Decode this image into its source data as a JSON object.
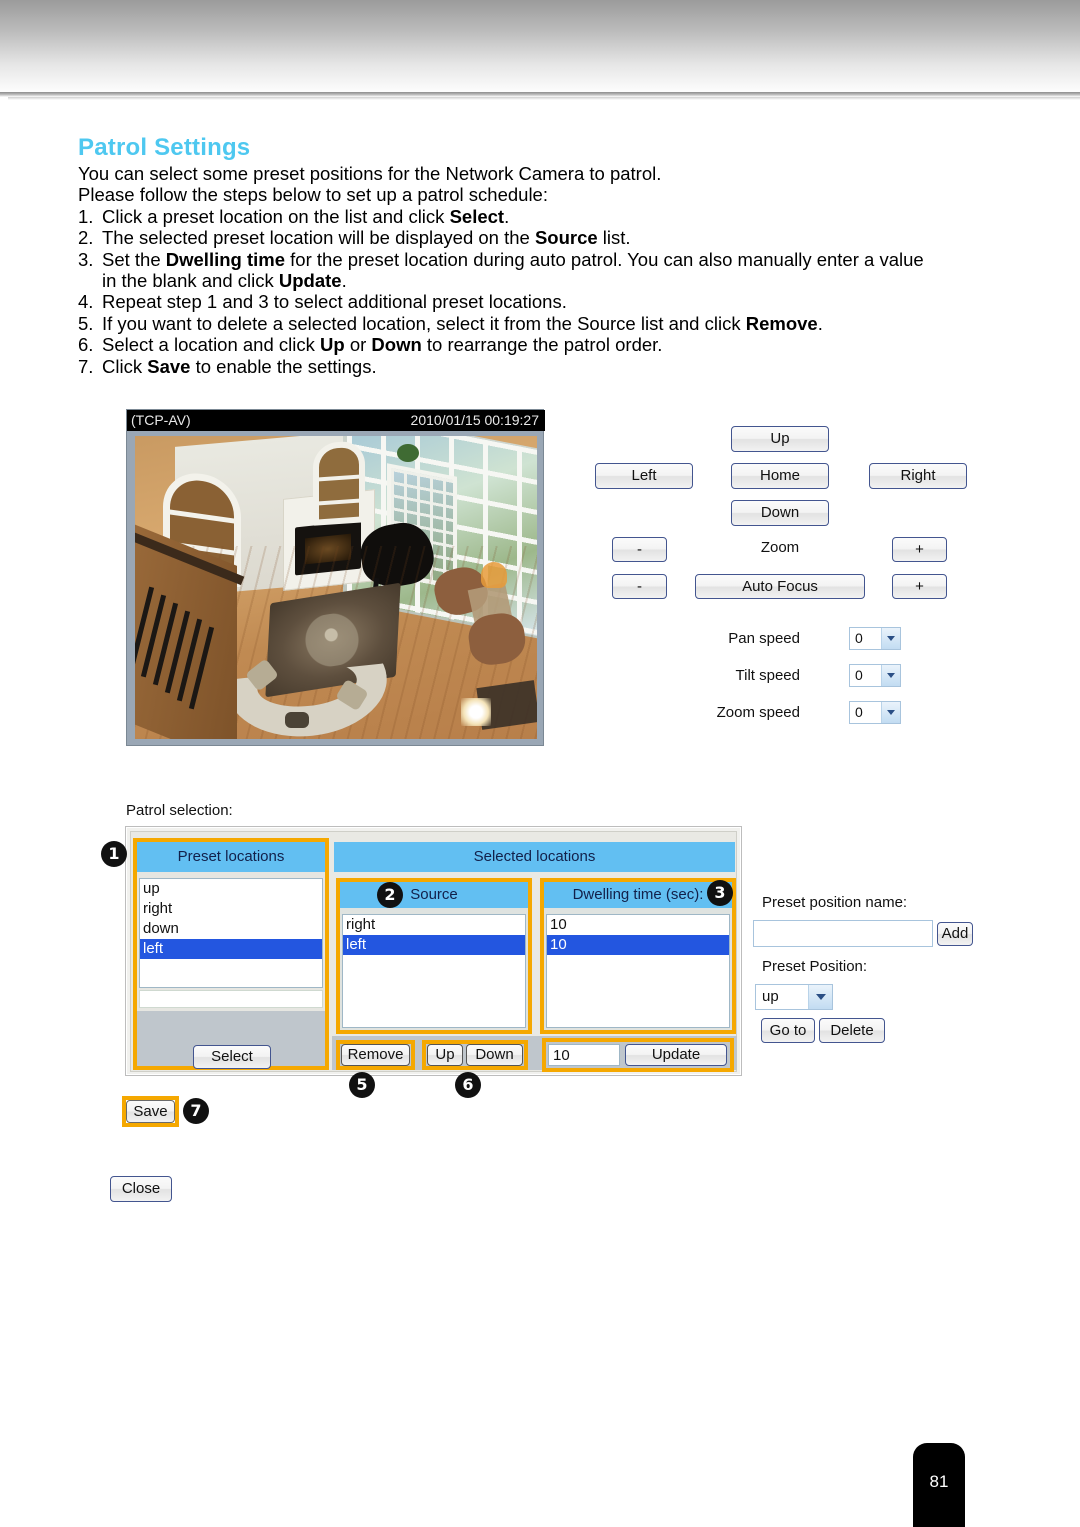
{
  "page": {
    "title": "Patrol Settings",
    "number": "81"
  },
  "intro": {
    "line1": "You can select some preset positions for the Network Camera to patrol.",
    "line2": "Please follow the steps below to set up a patrol schedule:",
    "steps": [
      {
        "num": "1.",
        "pre": "Click a preset location on the list and click ",
        "bold": "Select",
        "post": "."
      },
      {
        "num": "2.",
        "pre": "The selected preset location will be displayed on the ",
        "bold": "Source",
        "post": " list."
      },
      {
        "num": "3.",
        "pre": "Set the ",
        "bold": "Dwelling time",
        "post": " for the preset location during auto patrol. You can also manually enter a value",
        "cont_pre": "in the blank and click ",
        "cont_bold": "Update",
        "cont_post": "."
      },
      {
        "num": "4.",
        "pre": "Repeat step 1 and 3 to select additional preset locations.",
        "bold": "",
        "post": ""
      },
      {
        "num": "5.",
        "pre": "If you want to delete a selected location, select it from the Source list and click ",
        "bold": "Remove",
        "post": "."
      },
      {
        "num": "6.",
        "pre": "Select a location and click ",
        "bold": "Up",
        "mid": " or ",
        "bold2": "Down",
        "post": " to rearrange the patrol order."
      },
      {
        "num": "7.",
        "pre": "Click ",
        "bold": "Save",
        "post": " to enable the settings."
      }
    ]
  },
  "video": {
    "osd_left": "(TCP-AV)",
    "osd_time": "2010/01/15 00:19:27"
  },
  "ptz": {
    "up": "Up",
    "left": "Left",
    "home": "Home",
    "right": "Right",
    "down": "Down",
    "zoom_label": "Zoom",
    "zoom_minus": "-",
    "zoom_plus": "+",
    "focus_minus": "-",
    "focus_plus": "+",
    "auto_focus": "Auto Focus",
    "pan_speed_label": "Pan speed",
    "pan_speed_value": "0",
    "tilt_speed_label": "Tilt speed",
    "tilt_speed_value": "0",
    "zoom_speed_label": "Zoom speed",
    "zoom_speed_value": "0"
  },
  "patrol": {
    "section_label": "Patrol selection:",
    "preset_header": "Preset locations",
    "preset_items": [
      "up",
      "right",
      "down",
      "left"
    ],
    "preset_selected_index": 3,
    "select_button": "Select",
    "selected_header": "Selected locations",
    "source_header": "Source",
    "source_items": [
      "right",
      "left"
    ],
    "source_selected_index": 1,
    "dwell_header": "Dwelling time (sec):",
    "dwell_items": [
      "10",
      "10"
    ],
    "dwell_selected_index": 1,
    "remove_button": "Remove",
    "up_button": "Up",
    "down_button": "Down",
    "dwell_input_value": "10",
    "update_button": "Update",
    "save_button": "Save",
    "close_button": "Close"
  },
  "preset_form": {
    "name_label": "Preset position name:",
    "name_value": "",
    "name_placeholder": "",
    "add_button": "Add",
    "position_label": "Preset Position:",
    "position_value": "up",
    "goto_button": "Go to",
    "delete_button": "Delete"
  },
  "callouts": {
    "c1": "1",
    "c2": "2",
    "c3": "3",
    "c5": "5",
    "c6": "6",
    "c7": "7"
  },
  "colors": {
    "title": "#4ec8f0",
    "header_blue": "#62bff2",
    "highlight_orange": "#f5a800",
    "list_selection": "#2356e0"
  }
}
